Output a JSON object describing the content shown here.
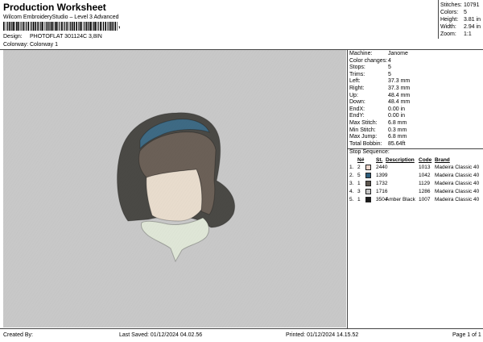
{
  "header": {
    "title": "Production Worksheet",
    "subtitle": "Wilcom EmbroideryStudio – Level 3 Advanced",
    "barcode_suffix": ",",
    "design_label": "Design:",
    "design_value": "PHOTOFLAT 301124C 3,8IN",
    "colorway_label": "Colorway:",
    "colorway_value": "Colorway 1"
  },
  "summary": [
    {
      "label": "Stitches:",
      "value": "10791"
    },
    {
      "label": "Colors:",
      "value": "5"
    },
    {
      "label": "Height:",
      "value": "3.81 in"
    },
    {
      "label": "Width:",
      "value": "2.94 in"
    },
    {
      "label": "Zoom:",
      "value": "1:1"
    }
  ],
  "machine_info": [
    {
      "label": "Machine:",
      "value": "Janome"
    },
    {
      "label": "Color changes:",
      "value": "4"
    },
    {
      "label": "Stops:",
      "value": "5"
    },
    {
      "label": "Trims:",
      "value": "5"
    },
    {
      "label": "Left:",
      "value": "37.3 mm"
    },
    {
      "label": "Right:",
      "value": "37.3 mm"
    },
    {
      "label": "Up:",
      "value": "48.4 mm"
    },
    {
      "label": "Down:",
      "value": "48.4 mm"
    },
    {
      "label": "EndX:",
      "value": "0.00 in"
    },
    {
      "label": "EndY:",
      "value": "0.00 in"
    },
    {
      "label": "Max Stitch:",
      "value": "6.8 mm"
    },
    {
      "label": "Min Stitch:",
      "value": "0.3 mm"
    },
    {
      "label": "Max Jump:",
      "value": "6.8 mm"
    },
    {
      "label": "Total Bobbin:",
      "value": "85.64ft"
    }
  ],
  "stop_sequence": {
    "title": "Stop Sequence:",
    "headers": {
      "num": "N#",
      "st": "St.",
      "description": "Description",
      "code": "Code",
      "brand": "Brand"
    },
    "rows": [
      {
        "order": "1.",
        "num": "2",
        "color": "#ecd6cc",
        "st": "2440",
        "description": "",
        "code": "1013",
        "brand": "Madeira Classic 40"
      },
      {
        "order": "2.",
        "num": "5",
        "color": "#2e5f7e",
        "st": "1399",
        "description": "",
        "code": "1042",
        "brand": "Madeira Classic 40"
      },
      {
        "order": "3.",
        "num": "1",
        "color": "#5d564e",
        "st": "1732",
        "description": "",
        "code": "1129",
        "brand": "Madeira Classic 40"
      },
      {
        "order": "4.",
        "num": "3",
        "color": "#c6c6c6",
        "st": "1716",
        "description": "",
        "code": "1286",
        "brand": "Madeira Classic 40"
      },
      {
        "order": "5.",
        "num": "1",
        "color": "#1c1c1c",
        "st": "3504",
        "description": "Amber Black",
        "code": "1007",
        "brand": "Madeira Classic 40"
      }
    ]
  },
  "footer": {
    "created_by": "Created By:",
    "last_saved": "Last Saved: 01/12/2024 04.02.56",
    "printed": "Printed: 01/12/2024 14.15.52",
    "page": "Page 1 of 1"
  },
  "colors": {
    "preview_bg": "#c8c8c8",
    "hair_outer": "#4a4945",
    "hair_band": "#3e6a84",
    "hair_inner": "#6b6057",
    "face": "#e8dccd",
    "collar": "#dfe6d7"
  }
}
